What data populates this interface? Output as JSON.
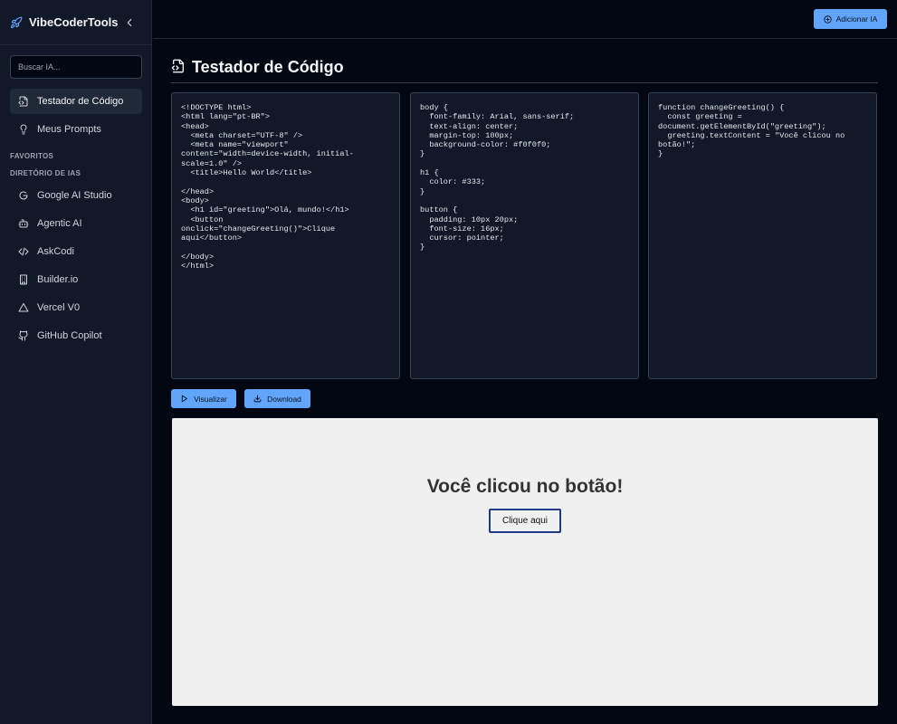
{
  "app": {
    "name": "VibeCoderTools"
  },
  "sidebar": {
    "search_placeholder": "Buscar IA...",
    "nav": [
      {
        "label": "Testador de Código",
        "icon": "code-file-icon",
        "active": true
      },
      {
        "label": "Meus Prompts",
        "icon": "lightbulb-icon",
        "active": false
      }
    ],
    "favorites_title": "FAVORITOS",
    "directory_title": "DIRETÓRIO DE IAS",
    "directory": [
      {
        "label": "Google AI Studio",
        "icon": "google-icon"
      },
      {
        "label": "Agentic AI",
        "icon": "bot-icon"
      },
      {
        "label": "AskCodi",
        "icon": "code-brackets-icon"
      },
      {
        "label": "Builder.io",
        "icon": "building-icon"
      },
      {
        "label": "Vercel V0",
        "icon": "triangle-icon"
      },
      {
        "label": "GitHub Copilot",
        "icon": "github-icon"
      }
    ]
  },
  "header": {
    "add_label": "Adicionar IA"
  },
  "main": {
    "title": "Testador de Código",
    "html_code": "<!DOCTYPE html>\n<html lang=\"pt-BR\">\n<head>\n  <meta charset=\"UTF-8\" />\n  <meta name=\"viewport\"\ncontent=\"width=device-width, initial-\nscale=1.0\" />\n  <title>Hello World</title>\n\n</head>\n<body>\n  <h1 id=\"greeting\">Olá, mundo!</h1>\n  <button\nonclick=\"changeGreeting()\">Clique\naqui</button>\n\n</body>\n</html>",
    "css_code": "body {\n  font-family: Arial, sans-serif;\n  text-align: center;\n  margin-top: 100px;\n  background-color: #f0f0f0;\n}\n\nh1 {\n  color: #333;\n}\n\nbutton {\n  padding: 10px 20px;\n  font-size: 16px;\n  cursor: pointer;\n}",
    "js_code": "function changeGreeting() {\n  const greeting =\ndocument.getElementById(\"greeting\");\n  greeting.textContent = \"Você clicou no\nbotão!\";\n}",
    "visualize_label": "Visualizar",
    "download_label": "Download",
    "preview": {
      "heading": "Você clicou no botão!",
      "button": "Clique aqui"
    }
  },
  "colors": {
    "accent": "#60a5fa",
    "background": "#030712",
    "panel": "#111827"
  }
}
